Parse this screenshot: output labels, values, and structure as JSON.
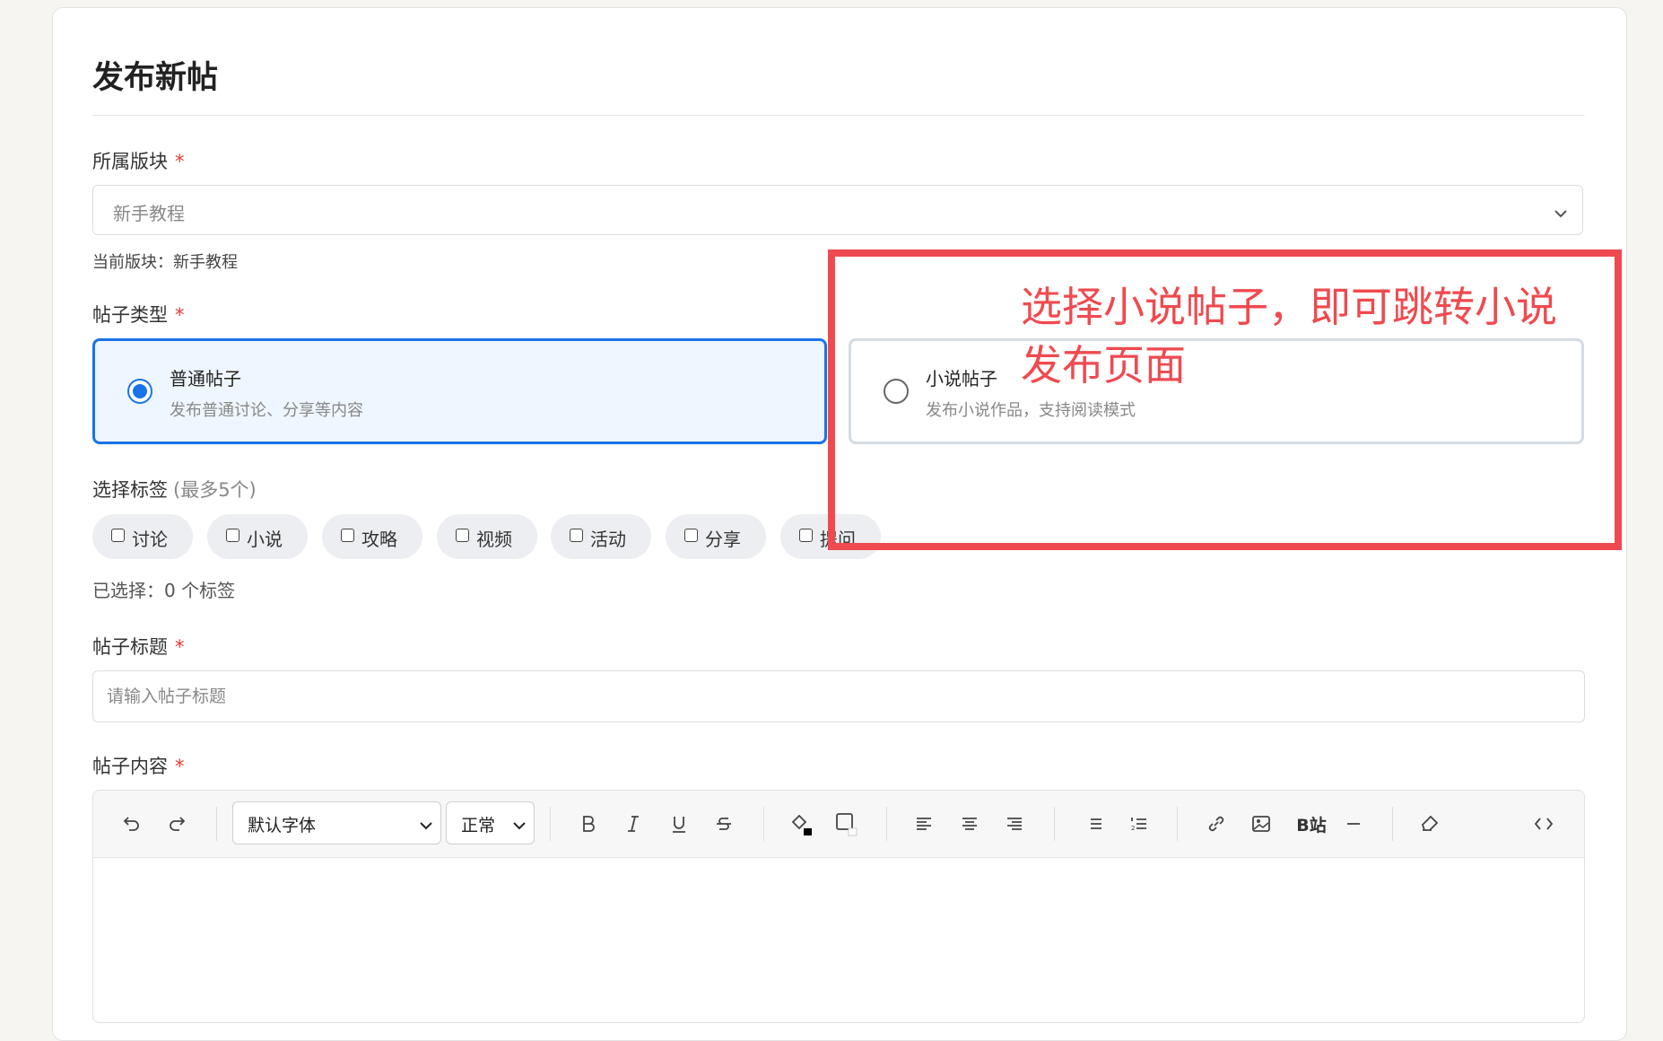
{
  "page": {
    "title": "发布新帖"
  },
  "board": {
    "label": "所属版块",
    "required_mark": "*",
    "selected": "新手教程",
    "current_info": "当前版块：新手教程"
  },
  "post_type": {
    "label": "帖子类型",
    "required_mark": "*",
    "options": [
      {
        "title": "普通帖子",
        "desc": "发布普通讨论、分享等内容",
        "selected": true
      },
      {
        "title": "小说帖子",
        "desc": "发布小说作品，支持阅读模式",
        "selected": false
      }
    ]
  },
  "tags": {
    "label": "选择标签",
    "hint": "(最多5个)",
    "items": [
      "讨论",
      "小说",
      "攻略",
      "视频",
      "活动",
      "分享",
      "提问"
    ],
    "selected_count_text": "已选择：0 个标签"
  },
  "title_field": {
    "label": "帖子标题",
    "required_mark": "*",
    "placeholder": "请输入帖子标题",
    "value": ""
  },
  "content": {
    "label": "帖子内容",
    "required_mark": "*",
    "toolbar": {
      "font_family": "默认字体",
      "heading": "正常",
      "bilibili_label": "B站",
      "icons": [
        "undo-icon",
        "redo-icon",
        "bold-icon",
        "italic-icon",
        "underline-icon",
        "strikethrough-icon",
        "text-color-icon",
        "background-color-icon",
        "align-left-icon",
        "align-center-icon",
        "align-right-icon",
        "bullet-list-icon",
        "numbered-list-icon",
        "link-icon",
        "image-icon",
        "divider-icon",
        "clear-format-icon",
        "code-view-icon"
      ]
    }
  },
  "annotation": {
    "text": "选择小说帖子，即可跳转小说发布页面",
    "color": "#ef4a4f"
  },
  "colors": {
    "accent": "#1a73e8",
    "required": "#e53935",
    "annotation": "#ef4a4f"
  }
}
